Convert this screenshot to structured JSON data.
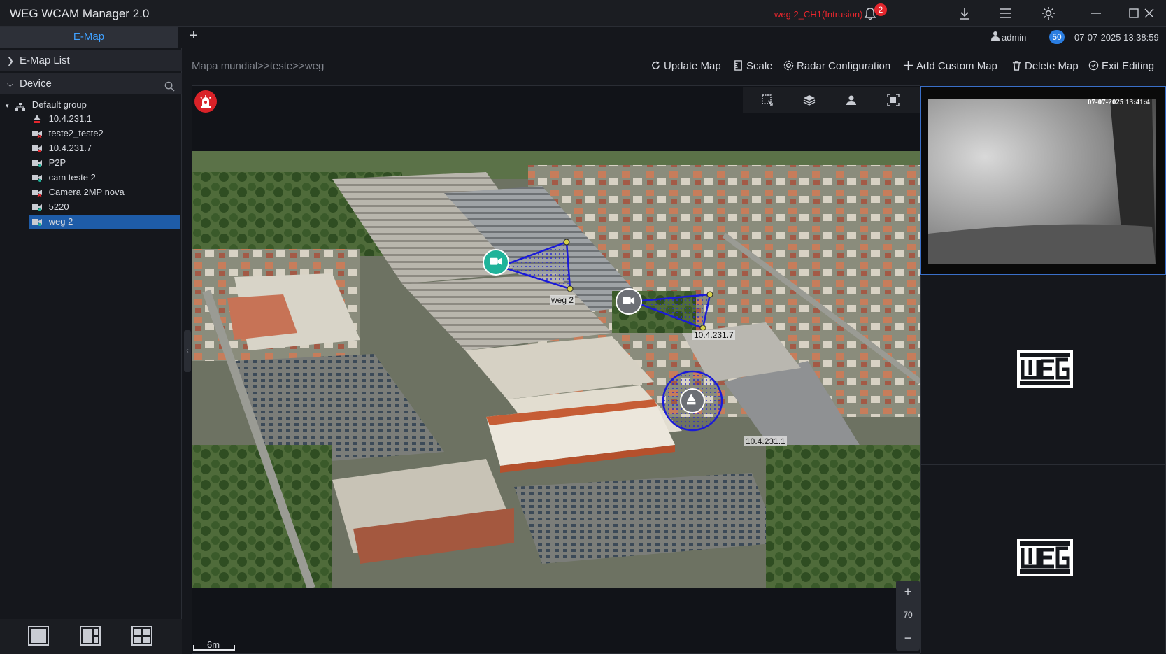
{
  "app": {
    "title": "WEG WCAM Manager 2.0",
    "alarm_text": "weg 2_CH1(Intrusion)",
    "alarm_count": "2",
    "user": "admin",
    "channel_count": "50",
    "datetime": "07-07-2025 13:38:59"
  },
  "tabs": {
    "emap_label": "E-Map",
    "add_label": "+"
  },
  "sidebar": {
    "emap_list_label": "E-Map List",
    "device_label": "Device",
    "group_label": "Default group",
    "devices": [
      {
        "label": "10.4.231.1",
        "icon": "sensor-icon"
      },
      {
        "label": "teste2_teste2",
        "icon": "camera-offline-icon"
      },
      {
        "label": "10.4.231.7",
        "icon": "camera-offline-icon"
      },
      {
        "label": "P2P",
        "icon": "camera-online-icon"
      },
      {
        "label": "cam teste 2",
        "icon": "camera-online-icon"
      },
      {
        "label": "Camera 2MP nova",
        "icon": "camera-offline-icon"
      },
      {
        "label": "5220",
        "icon": "camera-online-icon"
      },
      {
        "label": "weg 2",
        "icon": "camera-online-icon"
      }
    ]
  },
  "breadcrumb": "Mapa mundial>>teste>>weg",
  "toolbar": {
    "update_map": "Update Map",
    "scale": "Scale",
    "radar_config": "Radar Configuration",
    "add_custom_map": "Add Custom Map",
    "delete_map": "Delete Map",
    "exit_editing": "Exit Editing"
  },
  "map": {
    "markers": [
      {
        "label": "weg 2",
        "type": "camera-online"
      },
      {
        "label": "10.4.231.7",
        "type": "camera"
      },
      {
        "label": "10.4.231.1",
        "type": "alarm-sensor"
      }
    ],
    "zoom_level": "70",
    "zoom_in": "+",
    "zoom_out": "−",
    "scale_label": "6m"
  },
  "video": {
    "timestamp": "07-07-2025 13:41:4"
  },
  "colors": {
    "accent": "#3fa0ff",
    "alarm": "#e3262d",
    "selected": "#1e5ca8",
    "online_camera": "#1fb39a"
  }
}
